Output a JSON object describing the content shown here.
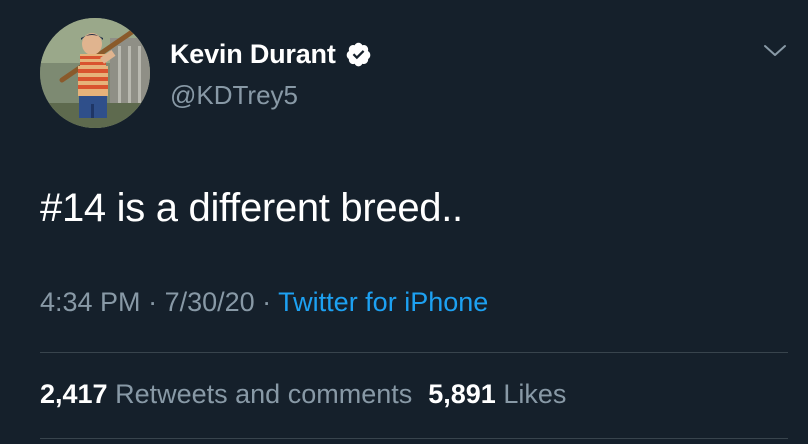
{
  "user": {
    "display_name": "Kevin Durant",
    "handle": "@KDTrey5",
    "verified_icon": "verified-badge-icon"
  },
  "menu_icon": "chevron-down-icon",
  "tweet": {
    "text": "#14 is a different breed.."
  },
  "meta": {
    "time": "4:34 PM",
    "sep1": " · ",
    "date": "7/30/20",
    "sep2": " · ",
    "source": "Twitter for iPhone"
  },
  "stats": {
    "retweets_count": "2,417",
    "retweets_label": "Retweets and comments",
    "likes_count": "5,891",
    "likes_label": "Likes"
  },
  "colors": {
    "background": "#15202b",
    "secondary_text": "#8899a6",
    "link": "#1da1f2",
    "divider": "#38444d"
  }
}
